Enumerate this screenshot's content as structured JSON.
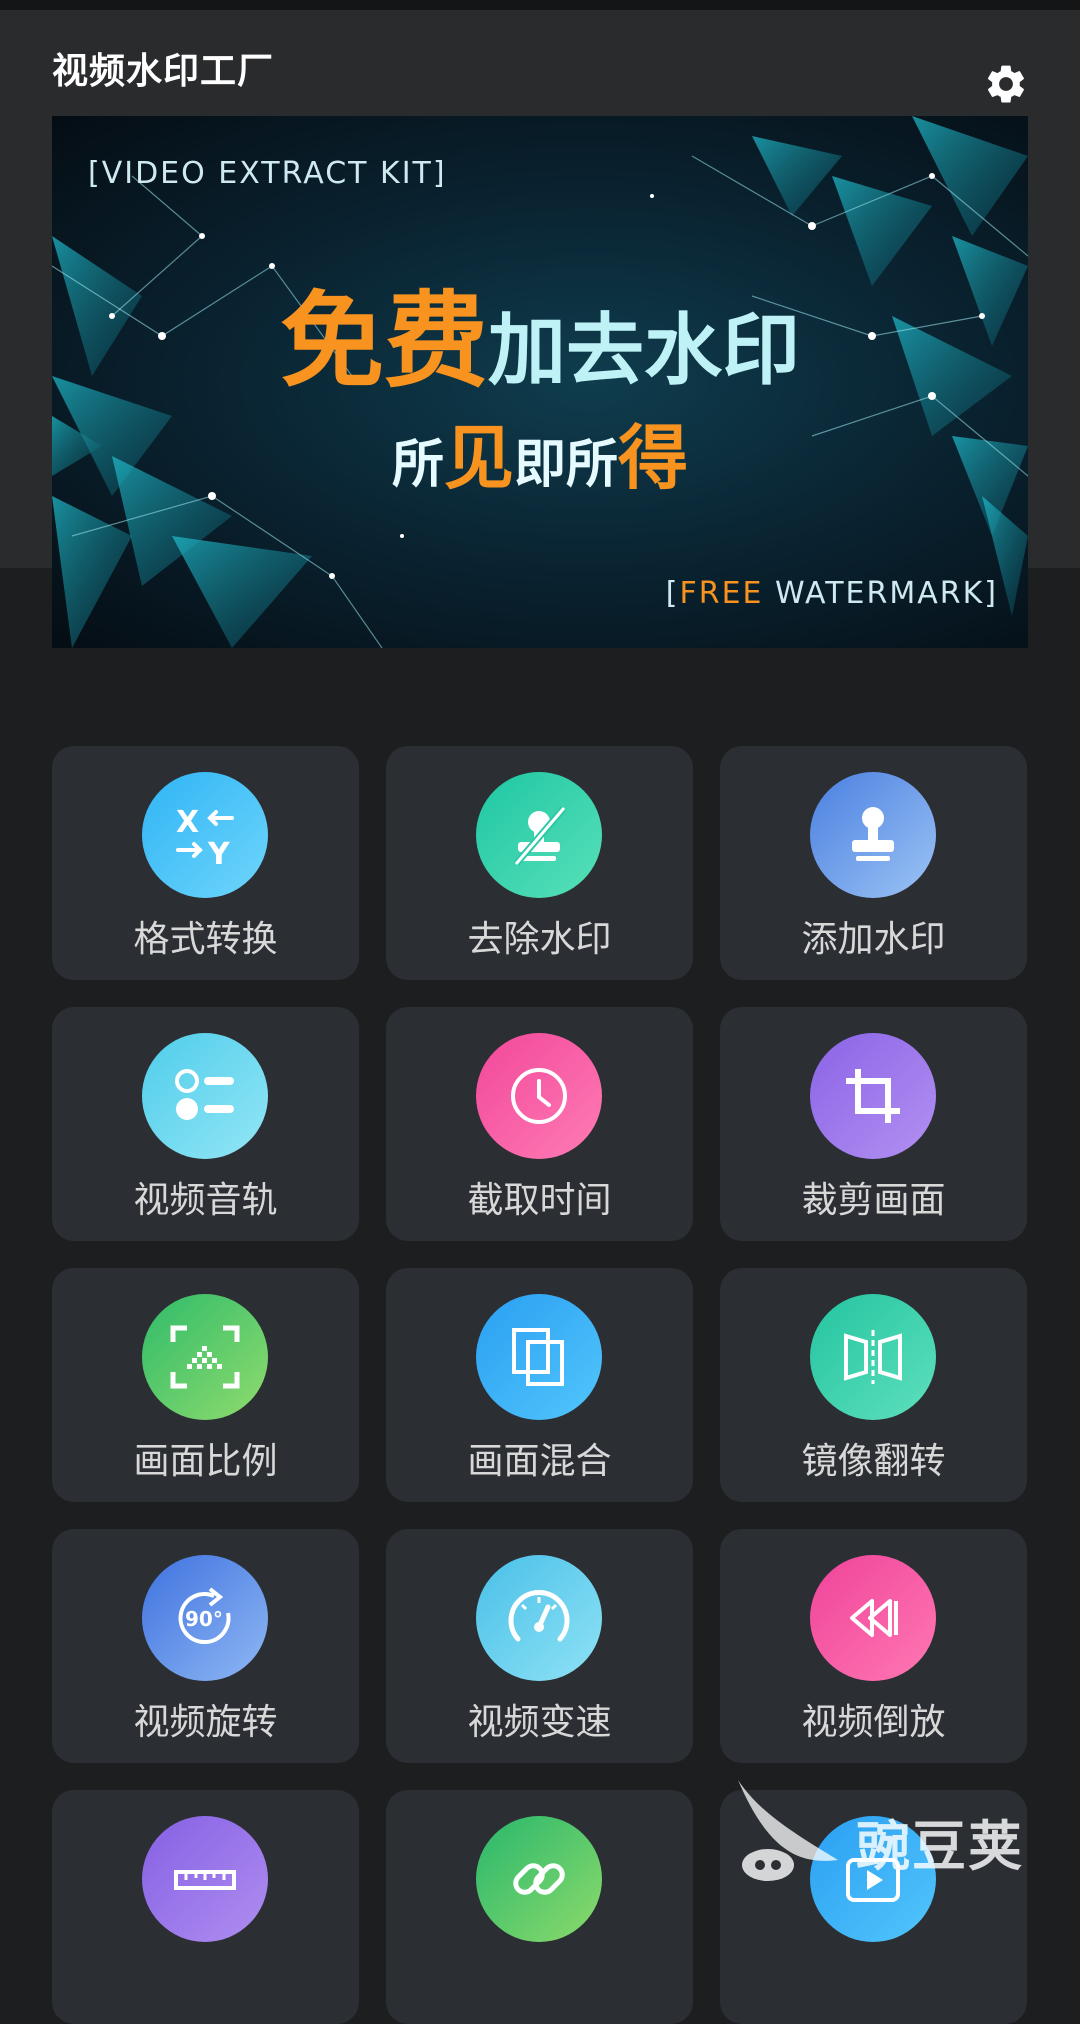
{
  "app": {
    "title": "视频水印工厂"
  },
  "header": {
    "settings_icon": "gear-icon"
  },
  "banner": {
    "tag_top": "[VIDEO EXTRACT KIT]",
    "headline_orange": "免费",
    "headline_cyan": "加去水印",
    "sub_part1": "所",
    "sub_highlight1": "见",
    "sub_part2": "即所",
    "sub_highlight2": "得",
    "tag_bottom_open": "[",
    "tag_bottom_highlight": "FREE",
    "tag_bottom_rest": " WATERMARK]"
  },
  "tools": [
    {
      "label": "格式转换",
      "icon": "format-convert-icon",
      "colors": [
        "#2fb4f5",
        "#6fd6fb"
      ]
    },
    {
      "label": "去除水印",
      "icon": "remove-watermark-icon",
      "colors": [
        "#1fc7a4",
        "#58e0b8"
      ]
    },
    {
      "label": "添加水印",
      "icon": "stamp-icon",
      "colors": [
        "#4a7fe0",
        "#9cc4f5"
      ]
    },
    {
      "label": "视频音轨",
      "icon": "audio-track-icon",
      "colors": [
        "#4fcdea",
        "#93e6f6"
      ]
    },
    {
      "label": "截取时间",
      "icon": "clock-icon",
      "colors": [
        "#f2479a",
        "#ff7cb5"
      ]
    },
    {
      "label": "裁剪画面",
      "icon": "crop-icon",
      "colors": [
        "#8a63e6",
        "#b391f2"
      ]
    },
    {
      "label": "画面比例",
      "icon": "aspect-ratio-icon",
      "colors": [
        "#2fbb6a",
        "#8fdc6d"
      ]
    },
    {
      "label": "画面混合",
      "icon": "layers-icon",
      "colors": [
        "#2a9ff2",
        "#52c6fb"
      ]
    },
    {
      "label": "镜像翻转",
      "icon": "mirror-flip-icon",
      "colors": [
        "#24c4a0",
        "#5ee0bd"
      ]
    },
    {
      "label": "视频旋转",
      "icon": "rotate-90-icon",
      "colors": [
        "#3f72e0",
        "#8fb8f3"
      ]
    },
    {
      "label": "视频变速",
      "icon": "speedometer-icon",
      "colors": [
        "#49c0e8",
        "#8fe2f5"
      ]
    },
    {
      "label": "视频倒放",
      "icon": "rewind-icon",
      "colors": [
        "#f0439a",
        "#ff78b3"
      ]
    },
    {
      "label": "",
      "icon": "ruler-icon",
      "colors": [
        "#8560e4",
        "#b08ef0"
      ]
    },
    {
      "label": "",
      "icon": "link-icon",
      "colors": [
        "#28b76d",
        "#8cdb6a"
      ]
    },
    {
      "label": "",
      "icon": "play-video-icon",
      "colors": [
        "#2a9ff2",
        "#52c6fb"
      ]
    }
  ],
  "watermark": {
    "text": "豌豆荚",
    "logo": "wandoujia-logo"
  }
}
